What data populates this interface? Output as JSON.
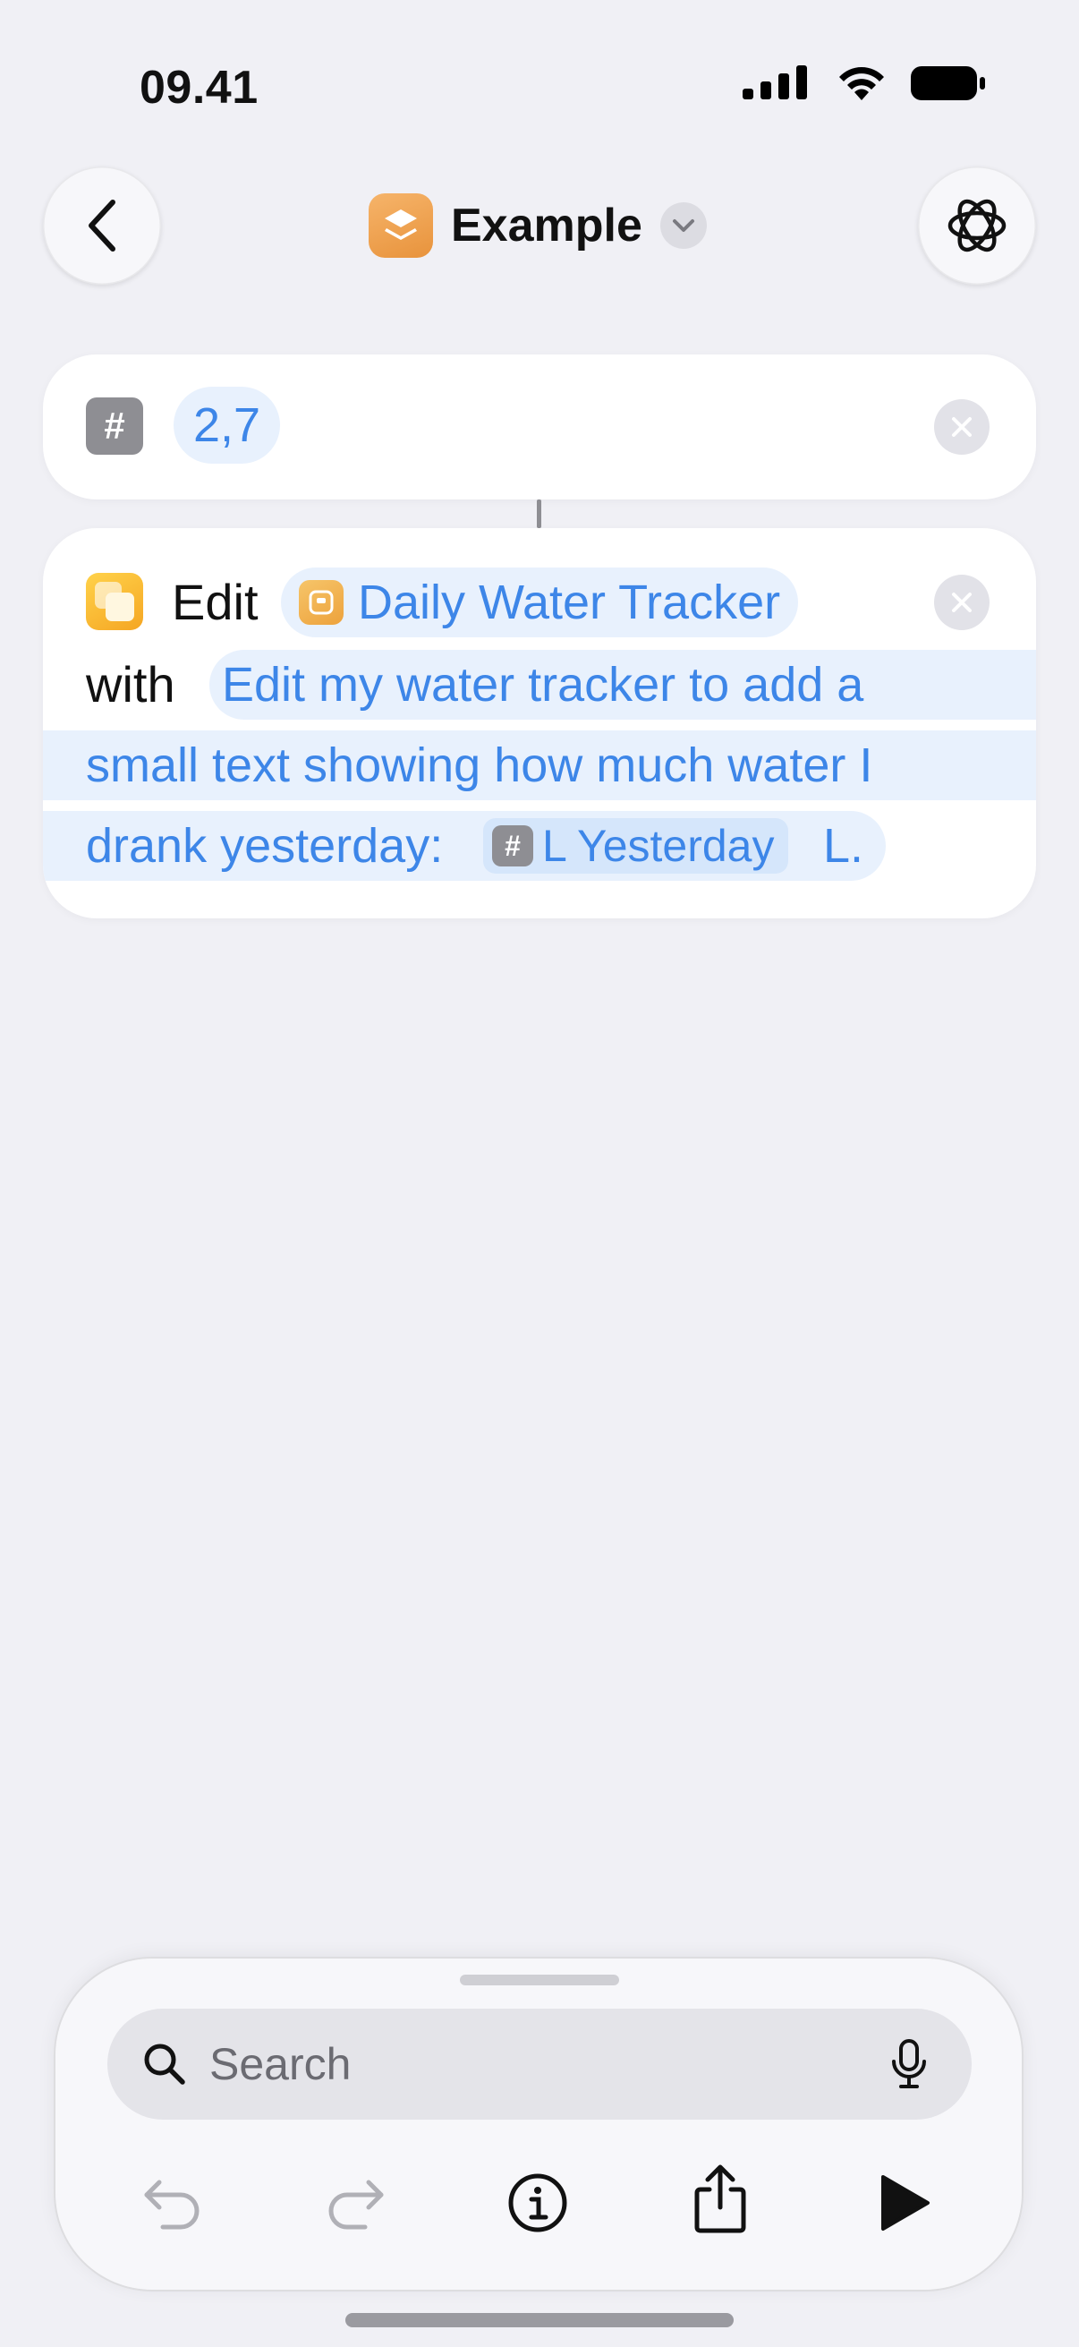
{
  "status_bar": {
    "time": "09.41"
  },
  "nav": {
    "title": "Example"
  },
  "number_action": {
    "value": "2,7"
  },
  "edit_action": {
    "verb": "Edit",
    "target": "Daily Water Tracker",
    "with_word": "with",
    "prompt_line1": "Edit my water tracker to add a",
    "prompt_line2": "small text showing how much water I",
    "prompt_line3": "drank yesterday:",
    "variable": "L Yesterday",
    "suffix": "L."
  },
  "bottom": {
    "search_placeholder": "Search"
  },
  "colors": {
    "accent": "#3d86e8",
    "pill_bg": "#e8f1fd",
    "background": "#f0f0f5"
  }
}
